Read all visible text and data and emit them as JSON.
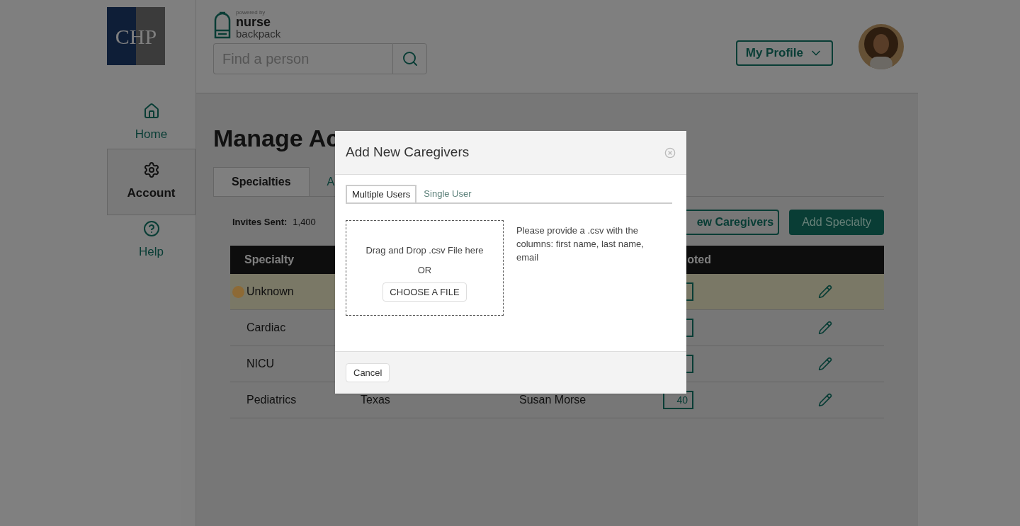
{
  "logo": {
    "text": "CHP"
  },
  "brand": {
    "powered_by": "powered by",
    "line1": "nurse",
    "line2": "backpack"
  },
  "search": {
    "placeholder": "Find a person"
  },
  "profile_menu": {
    "label": "My Profile"
  },
  "sidebar": {
    "items": [
      {
        "kind": "home",
        "label": "Home",
        "selected": false
      },
      {
        "kind": "gear",
        "label": "Account",
        "selected": true
      },
      {
        "kind": "help",
        "label": "Help",
        "selected": false
      }
    ]
  },
  "page": {
    "title": "Manage Ac",
    "tabs": [
      {
        "label": "Specialties",
        "selected": true
      },
      {
        "label": "A",
        "selected": false
      }
    ],
    "invites_label": "Invites Sent:",
    "invites_value": "1,400",
    "buttons": [
      {
        "label": "ew Caregivers",
        "kind": "outline"
      },
      {
        "label": "Add Specialty",
        "kind": "solid"
      }
    ],
    "table": {
      "columns": [
        "Specialty",
        "oted"
      ],
      "rows": [
        {
          "specialty": "Unknown",
          "highlighted": true,
          "color": "#8d6a35"
        },
        {
          "specialty": "Cardiac",
          "highlighted": false
        },
        {
          "specialty": "NICU",
          "highlighted": false
        },
        {
          "specialty": "Pediatrics",
          "highlighted": false,
          "state": "Texas",
          "manager": "Susan Morse",
          "count": "40"
        }
      ]
    }
  },
  "modal": {
    "title": "Add New Caregivers",
    "tabs": [
      {
        "label": "Multiple Users",
        "selected": true
      },
      {
        "label": "Single User",
        "selected": false
      }
    ],
    "drop_text": "Drag and Drop .csv File here",
    "or": "OR",
    "choose_button": "CHOOSE A FILE",
    "instructions": "Please provide a .csv with the columns: first name, last name, email",
    "cancel": "Cancel"
  }
}
